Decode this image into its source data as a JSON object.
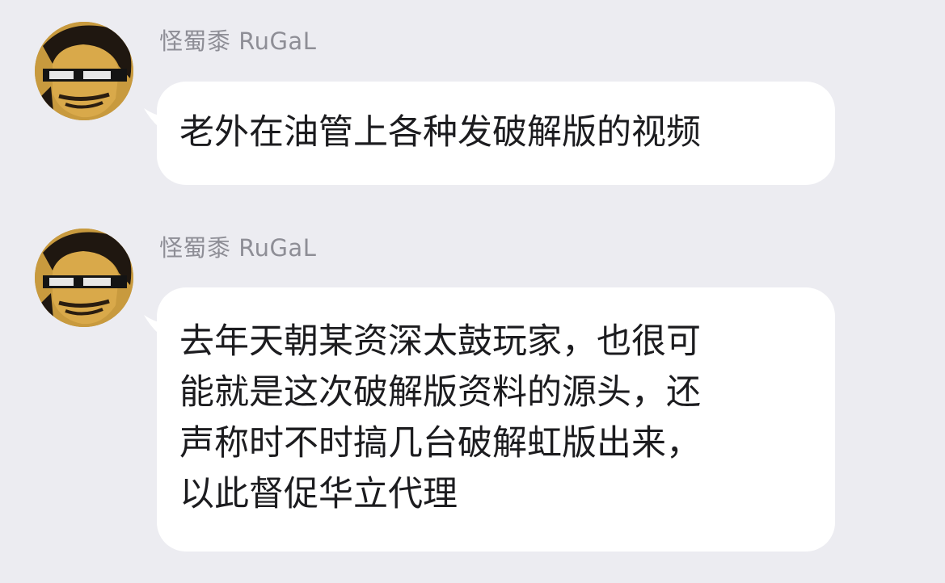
{
  "messages": [
    {
      "sender": "怪蜀黍 RuGaL",
      "avatar_icon": "sunglasses-man-avatar",
      "lines": [
        "老外在油管上各种发破解版的视频"
      ]
    },
    {
      "sender": "怪蜀黍 RuGaL",
      "avatar_icon": "sunglasses-man-avatar",
      "lines": [
        "去年天朝某资深太鼓玩家，也很可",
        "能就是这次破解版资料的源头，还",
        "声称时不时搞几台破解虹版出来，",
        "以此督促华立代理"
      ]
    }
  ],
  "colors": {
    "background": "#ececf1",
    "bubble": "#ffffff",
    "sender_name": "#8e8e96",
    "message_text": "#1c1c1f"
  }
}
